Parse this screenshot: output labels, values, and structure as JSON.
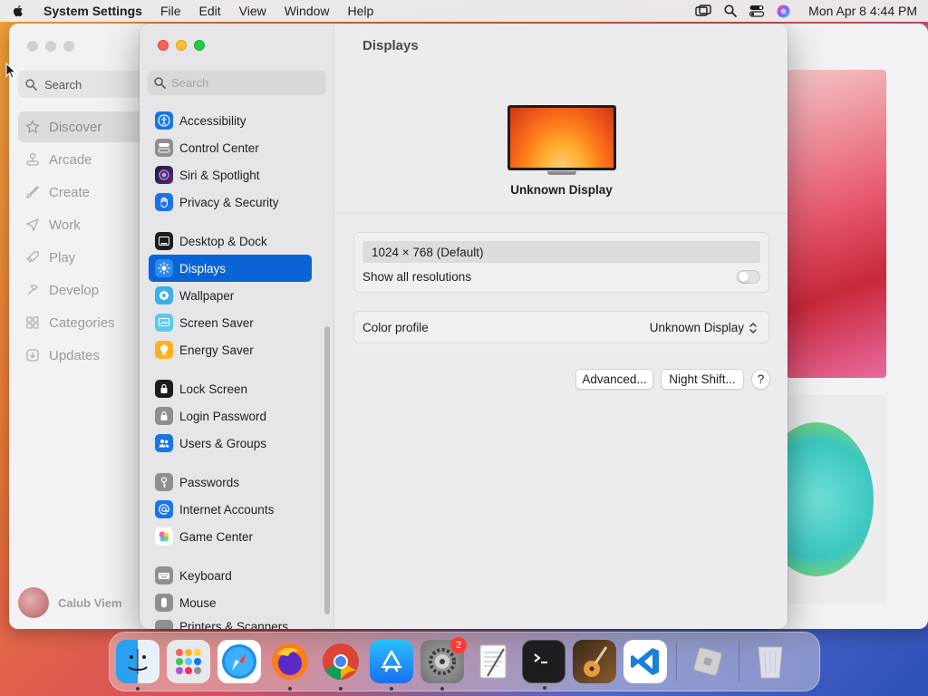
{
  "menubar": {
    "app_name": "System Settings",
    "items": [
      "File",
      "Edit",
      "View",
      "Window",
      "Help"
    ],
    "clock": "Mon Apr 8  4:44 PM"
  },
  "background_app": {
    "search_label": "Search",
    "nav": [
      "Discover",
      "Arcade",
      "Create",
      "Work",
      "Play",
      "Develop",
      "Categories",
      "Updates"
    ],
    "selected": "Discover",
    "user_name": "Calub Viem"
  },
  "settings": {
    "search_placeholder": "Search",
    "sidebar": {
      "group1": [
        "Accessibility",
        "Control Center",
        "Siri & Spotlight",
        "Privacy & Security"
      ],
      "group2": [
        "Desktop & Dock",
        "Displays",
        "Wallpaper",
        "Screen Saver",
        "Energy Saver"
      ],
      "group3": [
        "Lock Screen",
        "Login Password",
        "Users & Groups"
      ],
      "group4": [
        "Passwords",
        "Internet Accounts",
        "Game Center"
      ],
      "group5": [
        "Keyboard",
        "Mouse",
        "Printers & Scanners"
      ],
      "selected": "Displays"
    },
    "pane_title": "Displays",
    "display_name": "Unknown Display",
    "resolution": "1024 × 768 (Default)",
    "show_all_resolutions_label": "Show all resolutions",
    "show_all_resolutions_on": false,
    "color_profile_label": "Color profile",
    "color_profile_value": "Unknown Display",
    "advanced_button": "Advanced...",
    "night_shift_button": "Night Shift...",
    "help_button": "?"
  },
  "dock": {
    "apps": [
      "Finder",
      "Launchpad",
      "Safari",
      "Firefox",
      "Chrome",
      "App Store",
      "System Settings",
      "TextEdit",
      "Terminal",
      "GarageBand",
      "VS Code",
      "Roblox",
      "Trash"
    ],
    "settings_badge": "2"
  },
  "colors": {
    "accent": "#0a64d6"
  }
}
